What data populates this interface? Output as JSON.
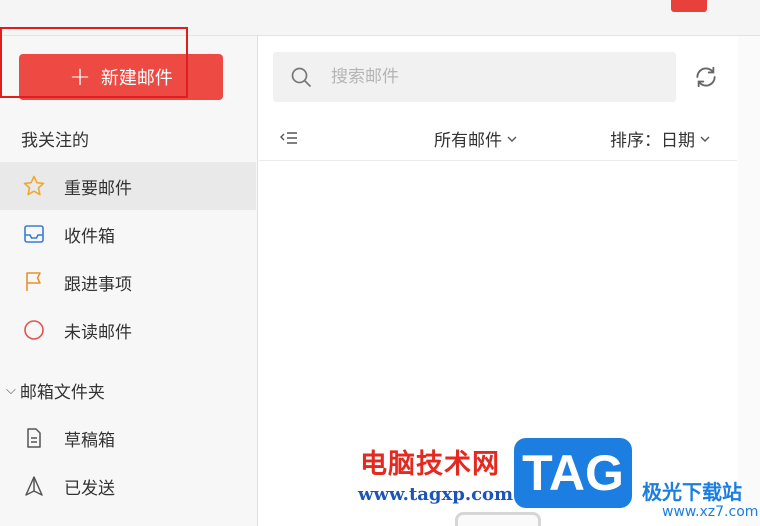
{
  "compose": {
    "label": "新建邮件"
  },
  "sections": {
    "followed": "我关注的",
    "folders": "邮箱文件夹"
  },
  "followed_items": [
    {
      "label": "重要邮件",
      "icon": "star-icon",
      "color": "#f0a830"
    },
    {
      "label": "收件箱",
      "icon": "inbox-icon",
      "color": "#3a7bd5"
    },
    {
      "label": "跟进事项",
      "icon": "flag-icon",
      "color": "#e8932c"
    },
    {
      "label": "未读邮件",
      "icon": "circle-icon",
      "color": "#e5534b"
    }
  ],
  "folder_items": [
    {
      "label": "草稿箱",
      "icon": "draft-icon"
    },
    {
      "label": "已发送",
      "icon": "sent-icon"
    }
  ],
  "search": {
    "placeholder": "搜索邮件"
  },
  "toolbar": {
    "filter_label": "所有邮件",
    "sort_label": "排序：日期"
  },
  "watermark": {
    "cn": "电脑技术网",
    "url": "www.tagxp.com",
    "tag": "TAG",
    "site": "极光下载站",
    "site_url": "www.xz7.com"
  },
  "colors": {
    "accent": "#ec4a43",
    "highlight": "#e01e1e"
  }
}
